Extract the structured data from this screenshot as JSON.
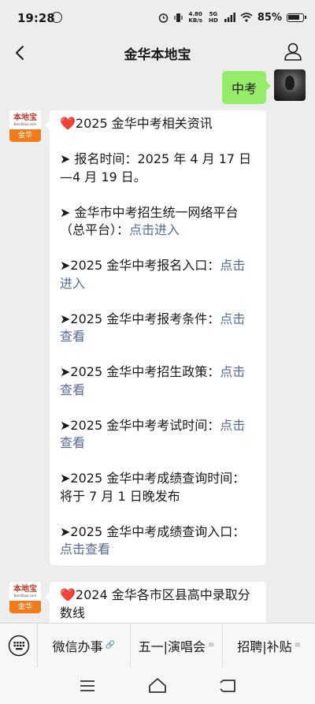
{
  "status": {
    "time": "19:28",
    "net_speed_value": "4.80",
    "net_speed_unit": "KB/s",
    "network": "5G HD",
    "battery": "85%"
  },
  "nav": {
    "title": "金华本地宝"
  },
  "sent": {
    "text": "中考"
  },
  "brand": {
    "name": "本地宝",
    "url": "Bendibao.com",
    "city": "金华"
  },
  "message1": {
    "paragraphs": [
      [
        {
          "t": "❤️2025 金华中考相关资讯"
        }
      ],
      [
        {
          "t": "➤ 报名时间：2025 年 4 月 17 日—4 月 19 日。"
        }
      ],
      [
        {
          "t": "➤ 金华市中考招生统一网络平台（总平台）："
        },
        {
          "t": "点击进入",
          "link": true
        }
      ],
      [
        {
          "t": "➤2025 金华中考报名入口："
        },
        {
          "t": "点击进入",
          "link": true
        }
      ],
      [
        {
          "t": "➤2025 金华中考报考条件："
        },
        {
          "t": "点击查看",
          "link": true
        }
      ],
      [
        {
          "t": "➤2025 金华中考招生政策："
        },
        {
          "t": "点击查看",
          "link": true
        }
      ],
      [
        {
          "t": "➤2025 金华中考考试时间："
        },
        {
          "t": "点击查看",
          "link": true
        }
      ],
      [
        {
          "t": "➤2025 金华中考成绩查询时间：将于 7 月 1 日晚发布"
        }
      ],
      [
        {
          "t": "➤2025 金华中考成绩查询入口："
        },
        {
          "t": "点击查看",
          "link": true
        }
      ]
    ]
  },
  "message2": {
    "paragraphs": [
      [
        {
          "t": "❤️2024 金华各市区县高中录取分数线"
        }
      ]
    ]
  },
  "menu": {
    "items": [
      {
        "label": "微信办事",
        "mark": "🔗"
      },
      {
        "label": "五一|演唱会",
        "mark": "≡"
      },
      {
        "label": "招聘|补贴",
        "mark": "≡"
      }
    ]
  }
}
